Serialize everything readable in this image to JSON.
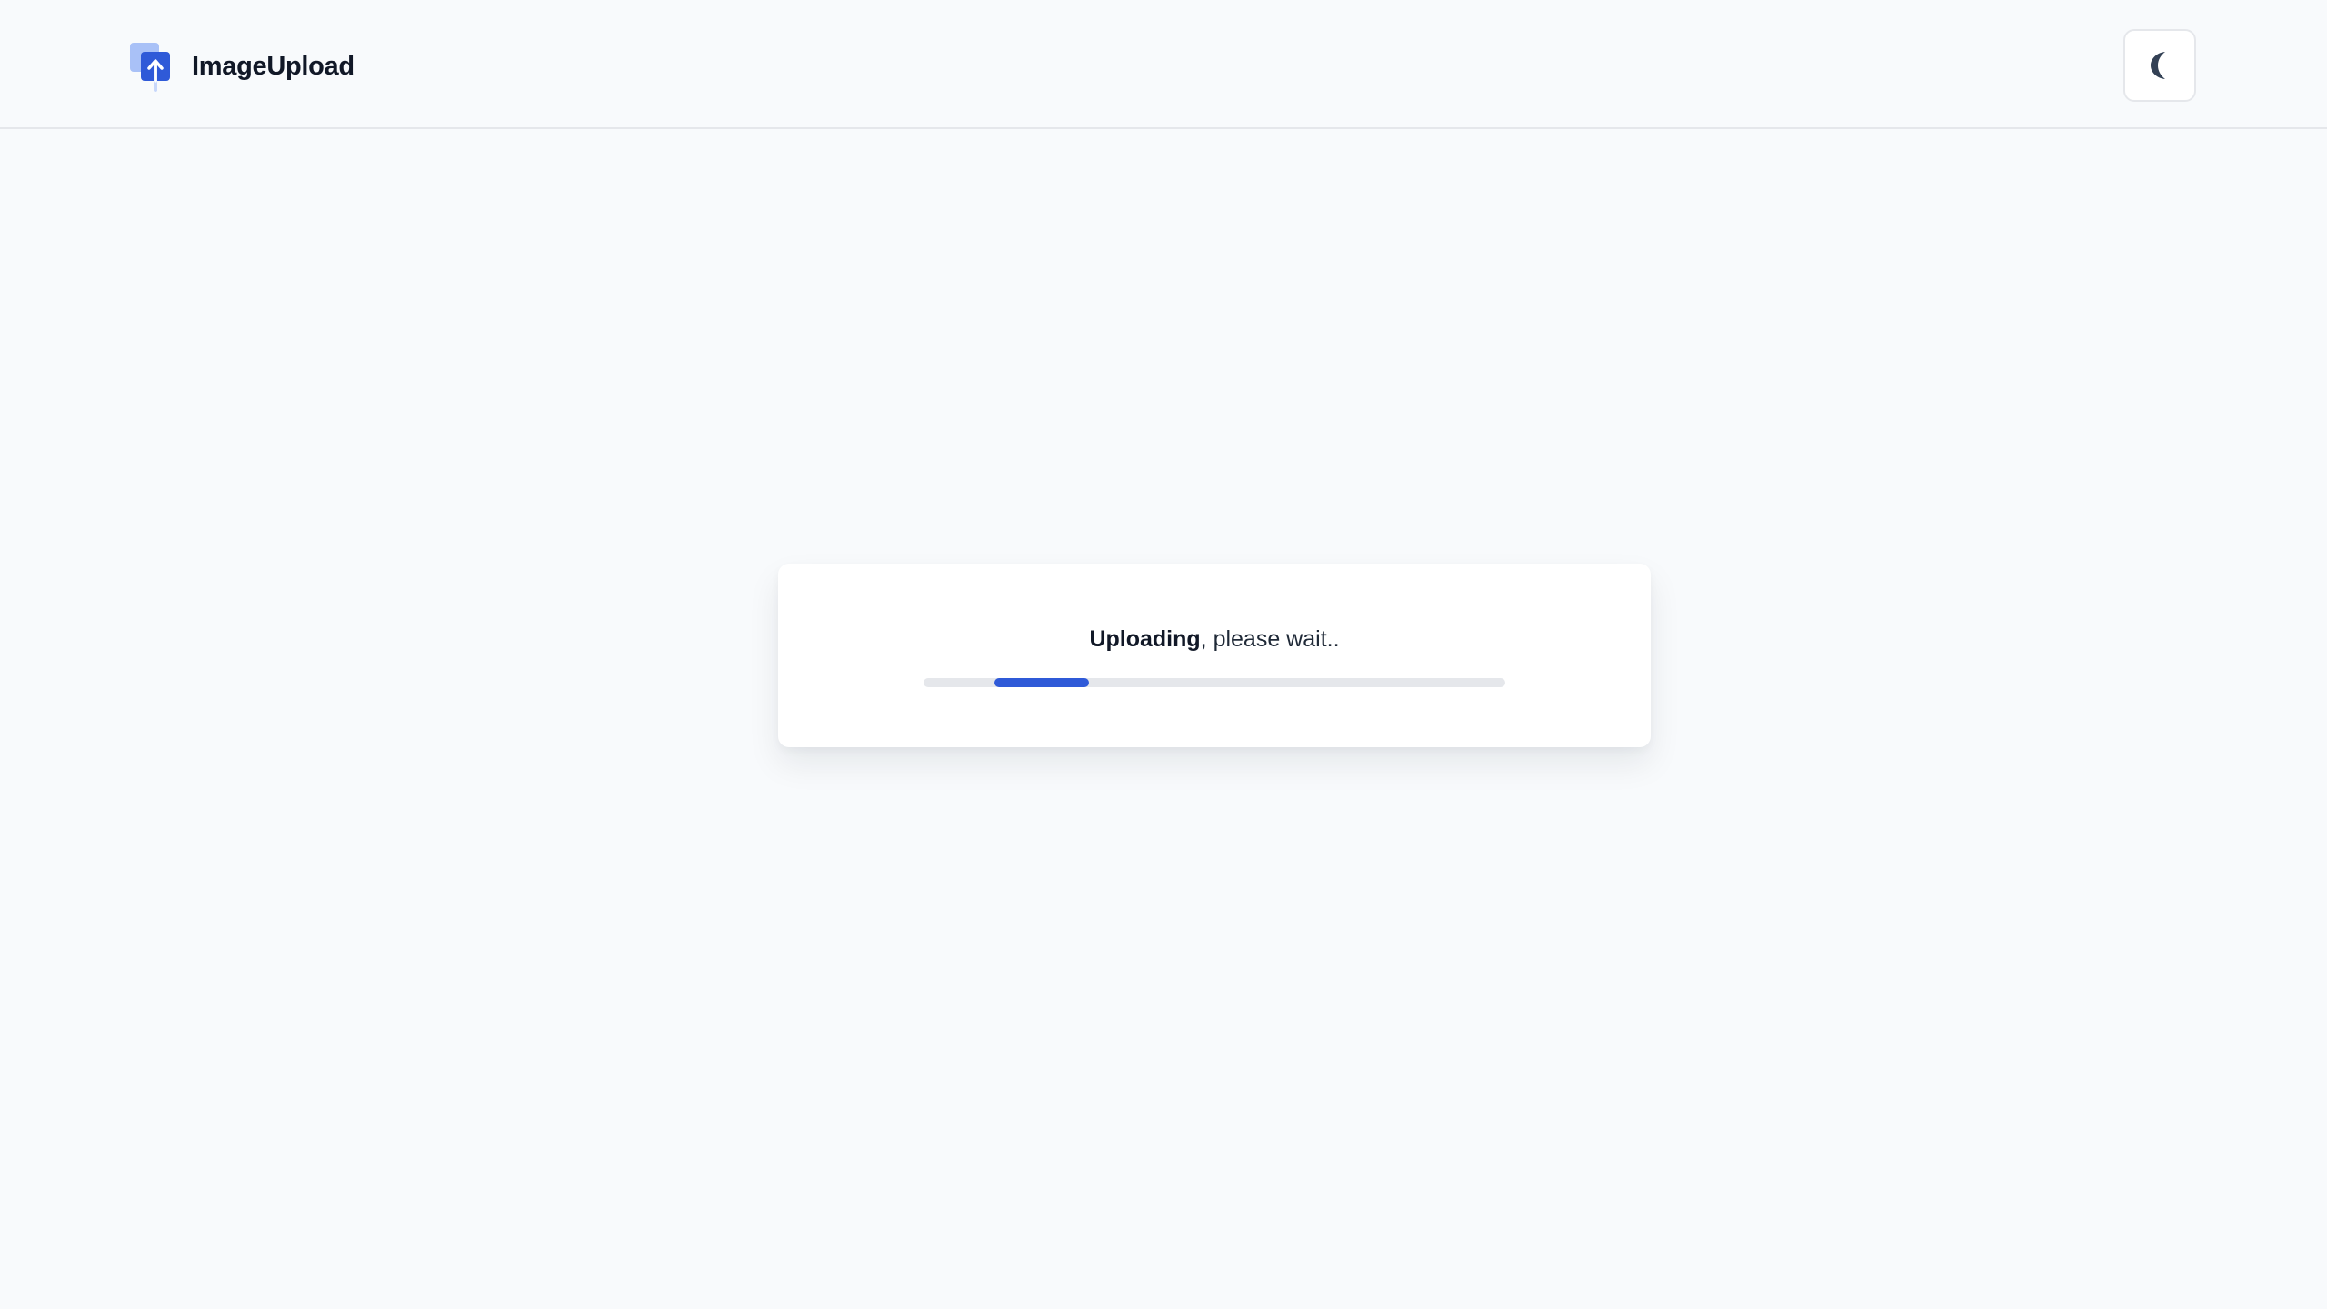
{
  "header": {
    "brand_name": "ImageUpload",
    "logo_icon": "image-upload-logo-icon",
    "theme_toggle_icon": "moon-icon"
  },
  "upload": {
    "status_strong": "Uploading",
    "status_rest": ", please wait..",
    "progress_state": "indeterminate"
  },
  "colors": {
    "accent": "#2f5ad8",
    "accent_light": "#9ab3f5",
    "background": "#f8fafc",
    "track": "#e5e7eb"
  }
}
